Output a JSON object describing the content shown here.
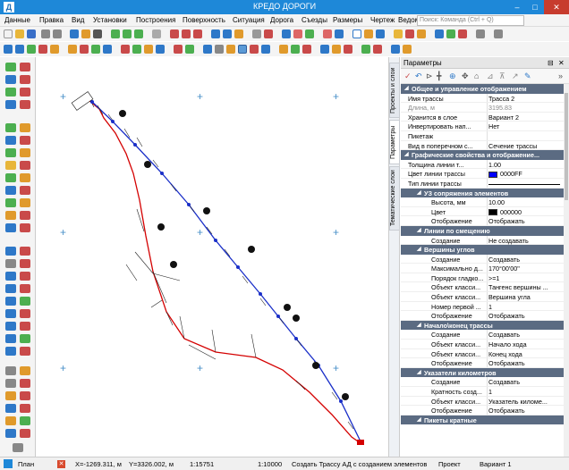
{
  "window": {
    "title": "КРЕДО ДОРОГИ",
    "app_icon": "Д"
  },
  "menu": [
    "Данные",
    "Правка",
    "Вид",
    "Установки",
    "Построения",
    "Поверхность",
    "Ситуация",
    "Дорога",
    "Съезды",
    "Размеры",
    "Чертеж",
    "Ведомости"
  ],
  "search": {
    "placeholder": "Поиск: Команда (Ctrl + Q)"
  },
  "side_tabs": [
    "Проекты и слои",
    "Параметры",
    "Тематические слои"
  ],
  "panel": {
    "title": "Параметры",
    "sections": [
      {
        "title": "Общее и управление отображением",
        "level": 0,
        "rows": [
          {
            "k": "Имя трассы",
            "v": "Трасса 2"
          },
          {
            "k": "Длина, м",
            "v": "3195.83",
            "muted": true
          },
          {
            "k": "Хранится в слое",
            "v": "Вариант 2"
          },
          {
            "k": "Инвертировать нап...",
            "v": "Нет"
          },
          {
            "k": "Пикетаж",
            "v": ""
          },
          {
            "k": "Вид в поперечном с...",
            "v": "Сечение трассы"
          }
        ]
      },
      {
        "title": "Графические свойства и отображение...",
        "level": 0,
        "rows": [
          {
            "k": "Толщина линии т...",
            "v": "1.00"
          },
          {
            "k": "Цвет линии трассы",
            "v": "0000FF",
            "swatch": "#0000ff"
          },
          {
            "k": "Тип линии трассы",
            "v": "",
            "line": true
          }
        ]
      },
      {
        "title": "УЗ сопряжения элементов",
        "level": 1,
        "rows": [
          {
            "k": "Высота, мм",
            "v": "10.00"
          },
          {
            "k": "Цвет",
            "v": "000000",
            "swatch": "#000000"
          },
          {
            "k": "Отображение",
            "v": "Отображать"
          }
        ]
      },
      {
        "title": "Линии по смещению",
        "level": 1,
        "rows": [
          {
            "k": "Создание",
            "v": "Не создавать"
          }
        ]
      },
      {
        "title": "Вершины углов",
        "level": 1,
        "rows": [
          {
            "k": "Создание",
            "v": "Создавать"
          },
          {
            "k": "Максимально д...",
            "v": "170°00'00\""
          },
          {
            "k": "Порядок гладко...",
            "v": ">=1"
          },
          {
            "k": "Объект класси...",
            "v": "Тангенс вершины ..."
          },
          {
            "k": "Объект класси...",
            "v": "Вершина угла"
          },
          {
            "k": "Номер первой ...",
            "v": "1"
          },
          {
            "k": "Отображение",
            "v": "Отображать"
          }
        ]
      },
      {
        "title": "Начало\\конец трассы",
        "level": 1,
        "rows": [
          {
            "k": "Создание",
            "v": "Создавать"
          },
          {
            "k": "Объект класси...",
            "v": "Начало хода"
          },
          {
            "k": "Объект класси...",
            "v": "Конец хода"
          },
          {
            "k": "Отображение",
            "v": "Отображать"
          }
        ]
      },
      {
        "title": "Указатели километров",
        "level": 1,
        "rows": [
          {
            "k": "Создание",
            "v": "Создавать"
          },
          {
            "k": "Кратность созд...",
            "v": "1"
          },
          {
            "k": "Объект класси...",
            "v": "Указатель киломе..."
          },
          {
            "k": "Отображение",
            "v": "Отображать"
          }
        ]
      },
      {
        "title": "Пикеты кратные",
        "level": 1,
        "rows": []
      }
    ]
  },
  "status": {
    "mode": "План",
    "x": "X=-1269.311, м",
    "y": "Y=3326.002, м",
    "scale": "1:15751",
    "scale2": "1:10000",
    "command": "Создать Трассу АД с созданием элементов",
    "project": "Проект",
    "variant": "Вариант 1"
  },
  "colors": {
    "title_bar": "#1e88d8",
    "section": "#5b6b82",
    "route_red": "#d40000",
    "route_blue": "#1a2fc8"
  },
  "icons": [
    "new-icon",
    "open-icon",
    "save-icon",
    "undo-icon",
    "redo-icon",
    "zoom-icon",
    "pan-icon",
    "select-icon",
    "snap-icon",
    "layers-icon"
  ]
}
